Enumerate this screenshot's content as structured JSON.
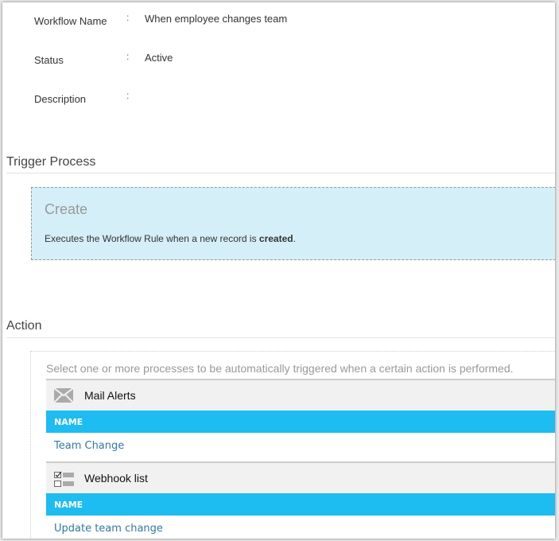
{
  "details": [
    {
      "label": "Workflow Name",
      "value": "When employee changes team"
    },
    {
      "label": "Status",
      "value": "Active"
    },
    {
      "label": "Description",
      "value": ""
    }
  ],
  "colon": ":",
  "trigger": {
    "heading": "Trigger Process",
    "title": "Create",
    "desc_prefix": "Executes the Workflow Rule when a new record is ",
    "desc_bold": "created",
    "desc_suffix": "."
  },
  "action": {
    "heading": "Action",
    "intro": "Select one or more processes to be automatically triggered when a certain action is performed.",
    "groups": [
      {
        "name": "Mail Alerts",
        "icon": "mail-icon",
        "column": "NAME",
        "items": [
          "Team Change"
        ]
      },
      {
        "name": "Webhook list",
        "icon": "checklist-icon",
        "column": "NAME",
        "items": [
          "Update team change"
        ]
      }
    ]
  },
  "colors": {
    "header_blue": "#1dbcf1",
    "trigger_bg": "#d4eff7",
    "link": "#2f7aa5"
  }
}
